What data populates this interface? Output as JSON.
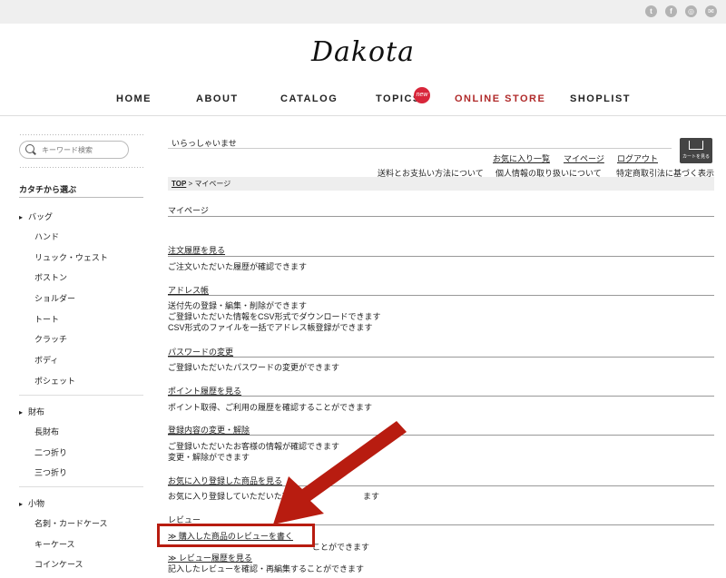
{
  "header": {
    "logo": "Dakota",
    "social": [
      "twitter-icon",
      "facebook-icon",
      "instagram-icon",
      "mail-icon"
    ],
    "nav": [
      "HOME",
      "ABOUT",
      "CATALOG",
      "TOPICS",
      "ONLINE STORE",
      "SHOPLIST"
    ],
    "topics_badge": "new"
  },
  "sidebar": {
    "search_placeholder": "キーワード検索",
    "heading": "カタチから選ぶ",
    "categories": [
      {
        "label": "バッグ",
        "items": [
          "ハンド",
          "リュック・ウェスト",
          "ボストン",
          "ショルダー",
          "トート",
          "クラッチ",
          "ボディ",
          "ポシェット"
        ]
      },
      {
        "label": "財布",
        "items": [
          "長財布",
          "二つ折り",
          "三つ折り"
        ]
      },
      {
        "label": "小物",
        "items": [
          "名刺・カードケース",
          "キーケース",
          "コインケース"
        ]
      }
    ]
  },
  "topbar": {
    "greeting": "いらっしゃいませ",
    "links1": [
      "お気に入り一覧",
      "マイページ",
      "ログアウト"
    ],
    "links2": [
      "送料とお支払い方法について",
      "個人情報の取り扱いについて",
      "特定商取引法に基づく表示"
    ],
    "cart_label": "カートを見る"
  },
  "breadcrumb": {
    "top": "TOP",
    "sep": " > ",
    "current": "マイページ"
  },
  "page_title": "マイページ",
  "sections": [
    {
      "title": "注文履歴を見る",
      "lines": [
        "ご注文いただいた履歴が確認できます"
      ]
    },
    {
      "title": "アドレス帳",
      "lines": [
        "送付先の登録・編集・削除ができます",
        "ご登録いただいた情報をCSV形式でダウンロードできます",
        "CSV形式のファイルを一括でアドレス帳登録ができます"
      ]
    },
    {
      "title": "パスワードの変更",
      "lines": [
        "ご登録いただいたパスワードの変更ができます"
      ]
    },
    {
      "title": "ポイント履歴を見る",
      "lines": [
        "ポイント取得、ご利用の履歴を確認することができます"
      ]
    },
    {
      "title": "登録内容の変更・解除",
      "lines": [
        "ご登録いただいたお客様の情報が確認できます",
        "変更・解除ができます"
      ]
    },
    {
      "title": "お気に入り登録した商品を見る",
      "lines": [
        "お気に入り登録していただいた商品の",
        "ます"
      ]
    }
  ],
  "review": {
    "heading": "レビュー",
    "link1": "≫ 購入した商品のレビューを書く",
    "desc1": "ことができます",
    "link2": "≫ レビュー履歴を見る",
    "desc2": "記入したレビューを確認・再編集することができます"
  },
  "colors": {
    "accent_red": "#b81c10",
    "store_red": "#b02a2a",
    "badge_red": "#d8263a"
  }
}
